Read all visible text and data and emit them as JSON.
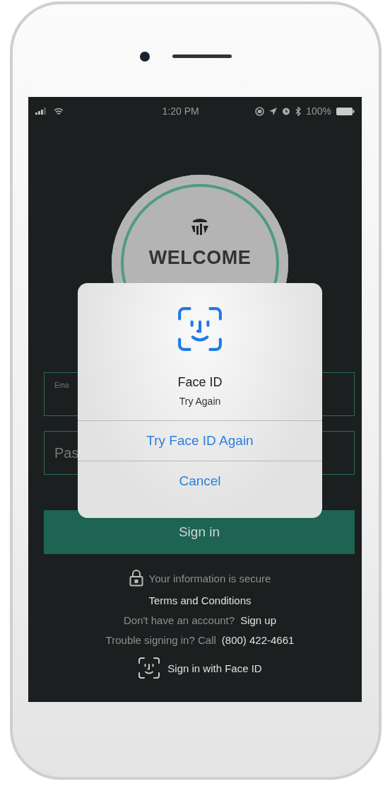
{
  "status_bar": {
    "time": "1:20 PM",
    "battery": "100%"
  },
  "logo": {
    "title": "WELCOME"
  },
  "form": {
    "email": {
      "label": "Ema"
    },
    "password": {
      "placeholder": "Pas"
    },
    "sign_in_button": "Sign in"
  },
  "footer": {
    "secure_note": "Your information is secure",
    "terms_link": "Terms and Conditions",
    "signup": {
      "text": "Don't have an account?",
      "link": "Sign up"
    },
    "support": {
      "text": "Trouble signing in? Call",
      "link": "(800) 422-4661"
    },
    "face_id_button": "Sign in with Face ID"
  },
  "alert": {
    "title": "Face ID",
    "message": "Try Again",
    "actions": [
      {
        "label": "Try Face ID Again"
      },
      {
        "label": "Cancel"
      }
    ]
  }
}
